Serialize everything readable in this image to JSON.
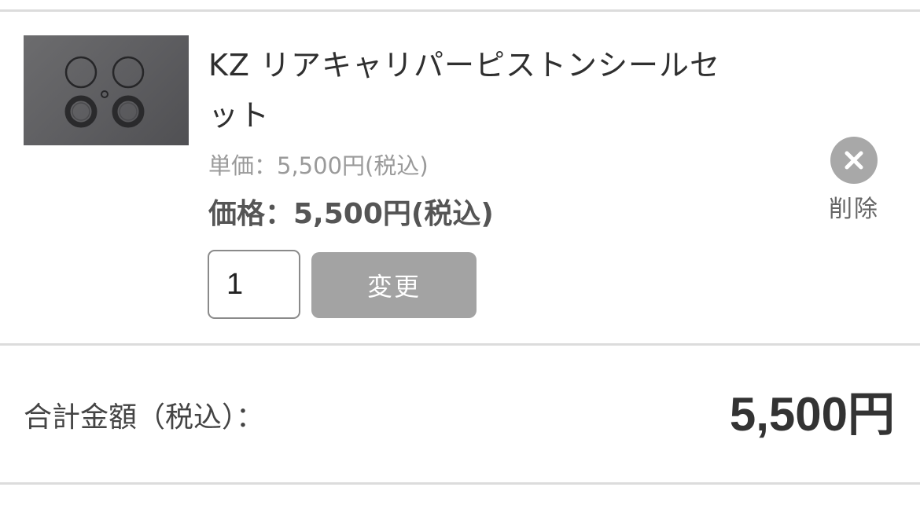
{
  "cart": {
    "items": [
      {
        "name": "KZ リアキャリパーピストンシールセット",
        "unit_price": "単価：5,500円(税込)",
        "price": "価格：5,500円(税込)",
        "quantity": "1",
        "change_label": "変更",
        "delete_label": "削除",
        "delete_icon": "close-circle-icon",
        "thumbnail_icon": "piston-seal-set-photo"
      }
    ],
    "total": {
      "label": "合計金額（税込）：",
      "value": "5,500円"
    }
  },
  "colors": {
    "change_button_bg": "#a3a3a3",
    "delete_icon_bg": "#a8a8a8",
    "divider": "#dcdcdc"
  }
}
